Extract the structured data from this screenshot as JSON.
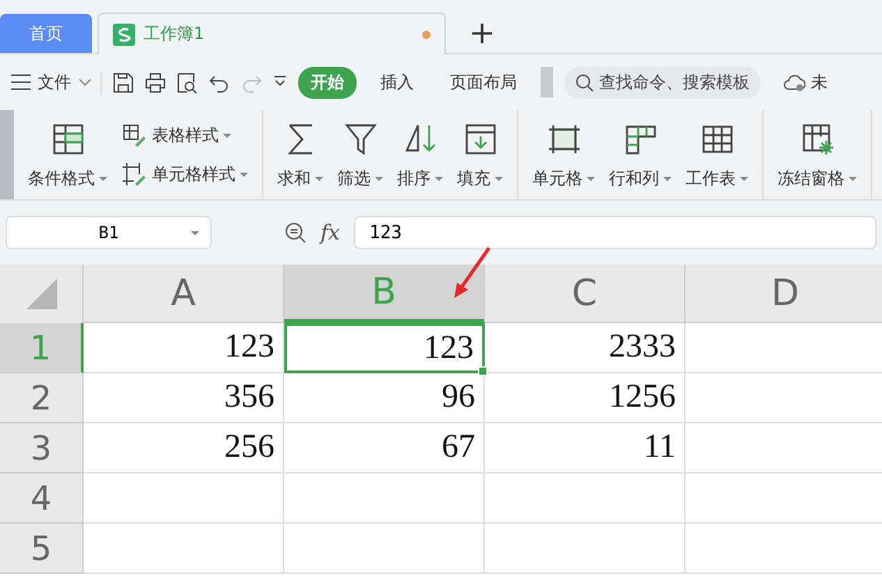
{
  "doc_tabs": [
    {
      "label": "首页",
      "kind": "home",
      "selected": false
    },
    {
      "label": "工作簿1",
      "kind": "doc",
      "selected": true,
      "unsaved": true
    }
  ],
  "menu": {
    "label": "文件"
  },
  "ribbon_tabs": [
    {
      "label": "开始",
      "selected": true
    },
    {
      "label": "插入",
      "selected": false
    },
    {
      "label": "页面布局",
      "selected": false
    }
  ],
  "search": {
    "placeholder": "查找命令、搜索模板"
  },
  "cloud": {
    "label": "未"
  },
  "ribbon_groups": [
    [
      {
        "label": "条件格式",
        "kind": "big"
      },
      {
        "kind": "stack",
        "items": [
          {
            "label": "表格样式"
          },
          {
            "label": "单元格样式"
          }
        ]
      }
    ],
    [
      {
        "label": "求和",
        "kind": "big"
      },
      {
        "label": "筛选",
        "kind": "big"
      },
      {
        "label": "排序",
        "kind": "big"
      },
      {
        "label": "填充",
        "kind": "big"
      }
    ],
    [
      {
        "label": "单元格",
        "kind": "big"
      },
      {
        "label": "行和列",
        "kind": "big"
      },
      {
        "label": "工作表",
        "kind": "big"
      }
    ],
    [
      {
        "label": "冻结窗格",
        "kind": "big"
      }
    ]
  ],
  "name_box": {
    "value": "B1"
  },
  "function_label": "fx",
  "formula": {
    "value": "123"
  },
  "columns": [
    {
      "label": "A",
      "selected": false
    },
    {
      "label": "B",
      "selected": true
    },
    {
      "label": "C",
      "selected": false
    },
    {
      "label": "D",
      "selected": false
    }
  ],
  "rows": [
    {
      "label": "1",
      "selected": true,
      "cells": [
        {
          "value": "123",
          "selected": false
        },
        {
          "value": "123",
          "selected": true
        },
        {
          "value": "2333",
          "selected": false
        },
        {
          "selected": false
        }
      ]
    },
    {
      "label": "2",
      "selected": false,
      "cells": [
        {
          "value": "356",
          "selected": false
        },
        {
          "value": "96",
          "selected": false
        },
        {
          "value": "1256",
          "selected": false
        },
        {
          "selected": false
        }
      ]
    },
    {
      "label": "3",
      "selected": false,
      "cells": [
        {
          "value": "256",
          "selected": false
        },
        {
          "value": "67",
          "selected": false
        },
        {
          "value": "11",
          "selected": false
        },
        {
          "selected": false
        }
      ]
    },
    {
      "label": "4",
      "selected": false,
      "cells": [
        {
          "selected": false
        },
        {
          "selected": false
        },
        {
          "selected": false
        },
        {
          "selected": false
        }
      ]
    },
    {
      "label": "5",
      "selected": false,
      "cells": [
        {
          "selected": false
        },
        {
          "selected": false
        },
        {
          "selected": false
        },
        {
          "selected": false
        }
      ]
    }
  ]
}
